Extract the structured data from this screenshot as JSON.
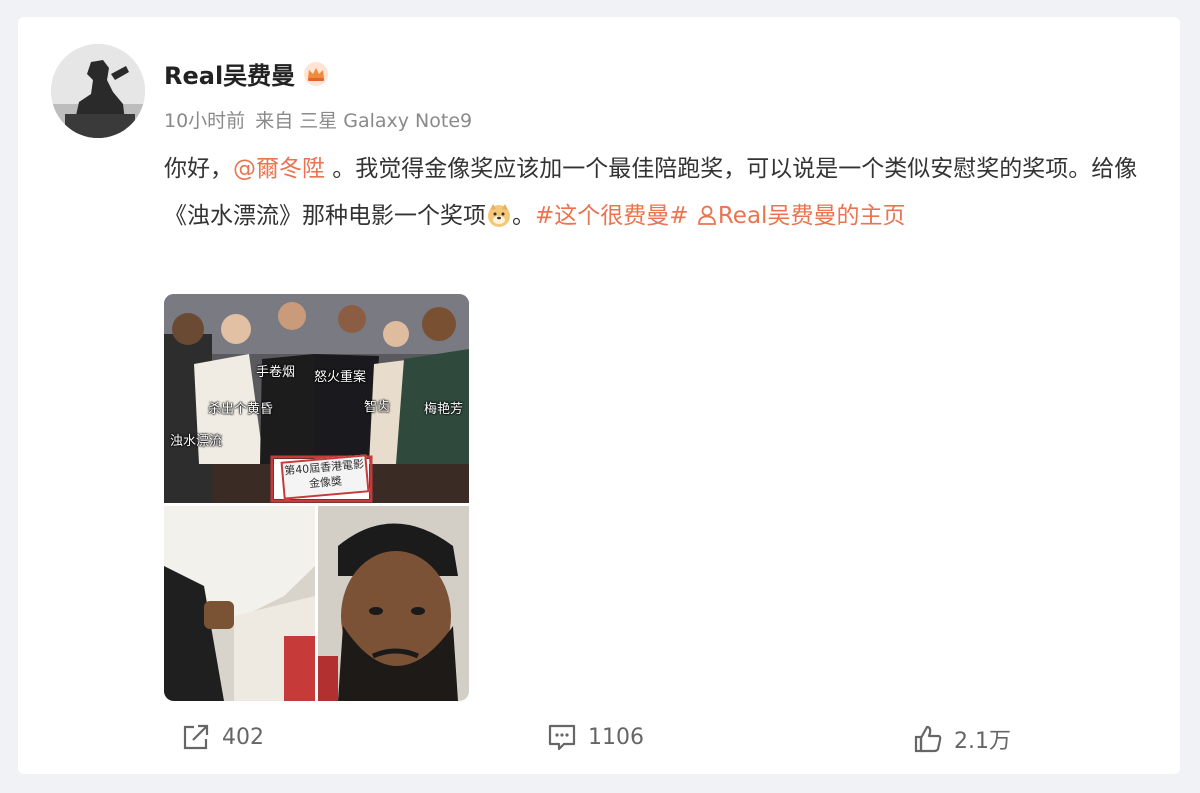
{
  "post": {
    "username": "Real吴费曼",
    "time": "10小时前",
    "source_prefix": "来自",
    "source_device": "三星 Galaxy Note9",
    "text_part1": "你好，",
    "mention": "@爾冬陞",
    "text_part2": " 。我觉得金像奖应该加一个最佳陪跑奖，可以说是一个类似安慰奖的奖项。给像《浊水漂流》那种电影一个奖项",
    "text_part3": "。",
    "hashtag": "#这个很费曼#",
    "profile_link": "Real吴费曼的主页"
  },
  "image": {
    "captions": {
      "c1": "手卷烟",
      "c2": "怒火重案",
      "c3": "杀出个黄昏",
      "c4": "智齿",
      "c5": "梅艳芳",
      "c6": "浊水漂流"
    },
    "cake_text": "第40屆香港電影金像獎"
  },
  "actions": {
    "repost_count": "402",
    "comment_count": "1106",
    "like_count": "2.1万"
  },
  "colors": {
    "link": "#eb7350",
    "text": "#333333",
    "meta": "#8a8a8a",
    "background": "#f1f2f5"
  },
  "icons": {
    "crown": "crown-icon",
    "emoji": "doge-emoji-icon",
    "profile": "person-icon",
    "repost": "share-icon",
    "comment": "comment-icon",
    "like": "thumbs-up-icon"
  }
}
